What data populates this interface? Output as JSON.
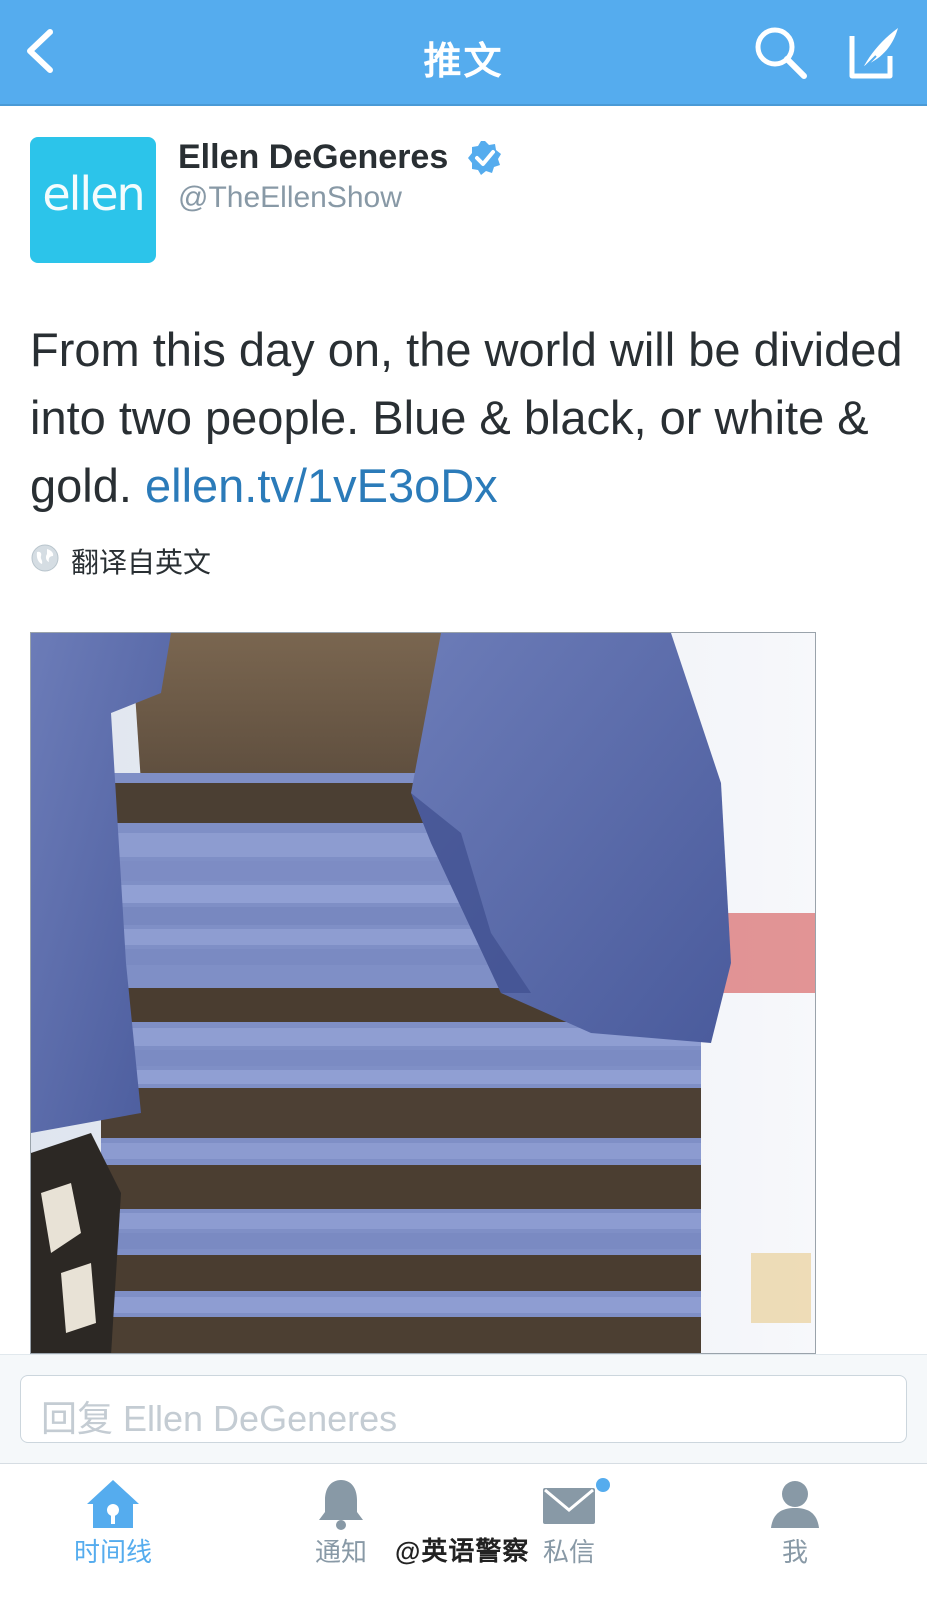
{
  "navbar": {
    "title": "推文",
    "back_icon": "chevron-left-icon",
    "search_icon": "search-icon",
    "compose_icon": "compose-icon",
    "bg_color": "#55acee"
  },
  "author": {
    "avatar_text": "ellen",
    "name": "Ellen DeGeneres",
    "handle": "@TheEllenShow",
    "verified_icon": "verified-badge-icon"
  },
  "tweet": {
    "text": "From this day on, the world will be divided into two people. Blue & black, or white & gold. ",
    "link": "ellen.tv/1vE3oDx",
    "link_color": "#2b7bb9"
  },
  "translate": {
    "icon": "globe-icon",
    "label": "翻译自英文"
  },
  "photo": {
    "subject": "dress photo"
  },
  "reply": {
    "placeholder": "回复 Ellen DeGeneres"
  },
  "tabbar": {
    "tabs": [
      {
        "label": "时间线",
        "icon": "home-icon",
        "active": true
      },
      {
        "label": "通知",
        "icon": "bell-icon",
        "active": false
      },
      {
        "label": "私信",
        "icon": "envelope-icon",
        "active": false,
        "badge": true
      },
      {
        "label": "我",
        "icon": "person-icon",
        "active": false
      }
    ],
    "watermark": "@英语警察"
  }
}
